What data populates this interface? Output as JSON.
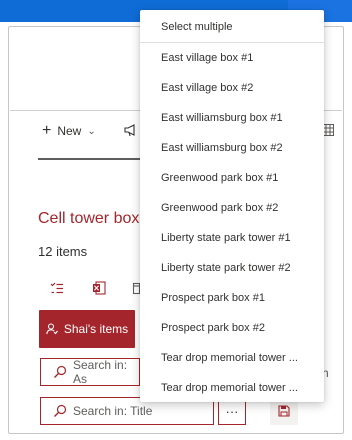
{
  "toolbar": {
    "new_label": "New",
    "new_chevron": "⌄"
  },
  "list": {
    "title": "Cell tower box",
    "item_count": "12 items"
  },
  "filters": {
    "shai_items_label": "Shai's items"
  },
  "search": {
    "assets_placeholder": "Search in: As",
    "right_fragment": "ch",
    "title_placeholder": "Search in: Title"
  },
  "buttons": {
    "more_label": "···"
  },
  "menu": {
    "header": "Select multiple",
    "items": [
      "East village box #1",
      "East village box #2",
      "East williamsburg box #1",
      "East williamsburg box #2",
      "Greenwood park box #1",
      "Greenwood park box #2",
      "Liberty state park tower #1",
      "Liberty state park tower #2",
      "Prospect park box #1",
      "Prospect park box #2",
      "Tear drop memorial tower ...",
      "Tear drop memorial tower ..."
    ]
  },
  "icons": {
    "new": "plus-icon",
    "announce": "megaphone-icon",
    "view": "grid-icon",
    "checklist": "checklist-icon",
    "excel": "excel-icon",
    "calendar": "calendar-icon",
    "person": "person-icon",
    "search": "search-icon",
    "save": "save-icon"
  },
  "colors": {
    "brand_blue": "#0f6cd6",
    "accent_red": "#a4262c",
    "text": "#323130",
    "muted": "#605e5c"
  }
}
